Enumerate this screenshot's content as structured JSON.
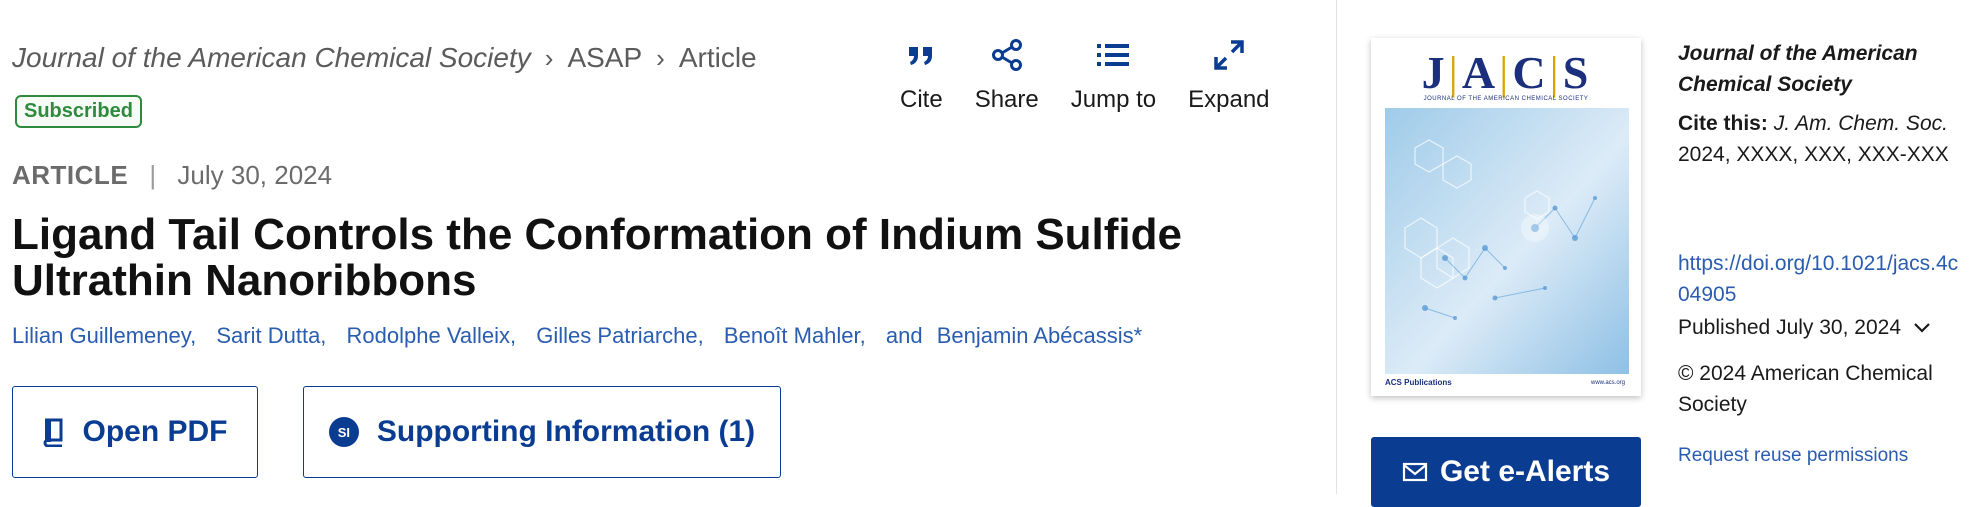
{
  "breadcrumb": {
    "journal": "Journal of the American Chemical Society",
    "section": "ASAP",
    "current": "Article"
  },
  "access_badge": "Subscribed",
  "toolbar": {
    "cite": "Cite",
    "share": "Share",
    "jump": "Jump to",
    "expand": "Expand"
  },
  "article": {
    "type": "ARTICLE",
    "date": "July 30, 2024",
    "title": "Ligand Tail Controls the Conformation of Indium Sulfide Ultrathin Nanoribbons",
    "authors": [
      "Lilian Guillemeney,",
      "Sarit Dutta,",
      "Rodolphe Valleix,",
      "Gilles Patriarche,",
      "Benoît Mahler,",
      "and",
      "Benjamin Abécassis*"
    ]
  },
  "actions": {
    "open_pdf": "Open PDF",
    "si_badge": "SI",
    "supporting_info": "Supporting Information (1)"
  },
  "sidebar": {
    "cover": {
      "logo_letters": [
        "J",
        "A",
        "C",
        "S"
      ],
      "subtitle": "JOURNAL OF THE AMERICAN CHEMICAL SOCIETY",
      "publisher": "ACS Publications",
      "url": "www.acs.org"
    },
    "journal": "Journal of the American Chemical Society",
    "cite_label": "Cite this:",
    "cite_journal": "J. Am. Chem. Soc.",
    "cite_rest": "2024, XXXX, XXX, XXX-XXX",
    "doi": "https://doi.org/10.1021/jacs.4c04905",
    "published": "Published July 30, 2024",
    "copyright": "© 2024 American Chemical Society",
    "reuse": "Request reuse permissions",
    "alerts": "Get e-Alerts"
  },
  "colors": {
    "accent": "#0a3d91",
    "link": "#2a5db0",
    "badge_green": "#2e8b3e"
  }
}
